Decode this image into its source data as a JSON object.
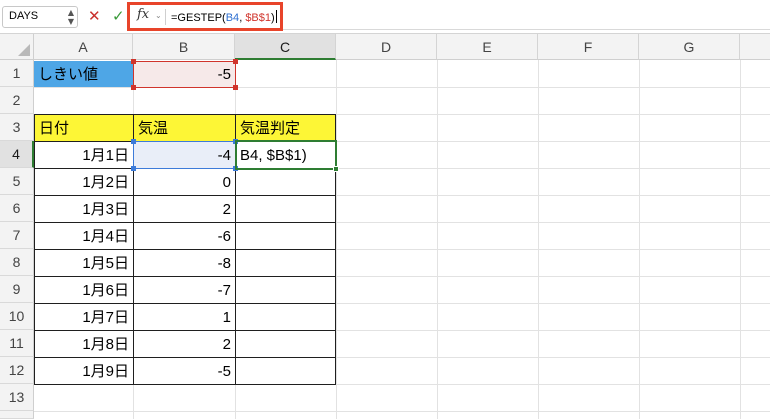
{
  "name_box": {
    "value": "DAYS"
  },
  "formula_bar": {
    "fx_label": "fx",
    "formula_prefix": "=GESTEP(",
    "ref1": "B4",
    "separator": ", ",
    "ref2": "$B$1",
    "suffix": ")"
  },
  "columns": [
    "A",
    "B",
    "C",
    "D",
    "E",
    "F",
    "G"
  ],
  "rows": [
    "1",
    "2",
    "3",
    "4",
    "5",
    "6",
    "7",
    "8",
    "9",
    "10",
    "11",
    "12",
    "13"
  ],
  "cells": {
    "a1": "しきい値",
    "b1": "-5",
    "a3": "日付",
    "b3": "気温",
    "c3": "気温判定",
    "c4": "B4, $B$1)",
    "data_rows": [
      {
        "date": "1月1日",
        "temp": "-4"
      },
      {
        "date": "1月2日",
        "temp": "0"
      },
      {
        "date": "1月3日",
        "temp": "2"
      },
      {
        "date": "1月4日",
        "temp": "-6"
      },
      {
        "date": "1月5日",
        "temp": "-8"
      },
      {
        "date": "1月6日",
        "temp": "-7"
      },
      {
        "date": "1月7日",
        "temp": "1"
      },
      {
        "date": "1月8日",
        "temp": "2"
      },
      {
        "date": "1月9日",
        "temp": "-5"
      }
    ]
  },
  "colors": {
    "threshold_label_fill": "#4ea6e6",
    "header_fill": "#fdf636",
    "formula_highlight_border": "#e8442a",
    "ref_blue": "#2e6fd1",
    "ref_red": "#d0342c",
    "active_cell_border": "#2e7d32"
  }
}
